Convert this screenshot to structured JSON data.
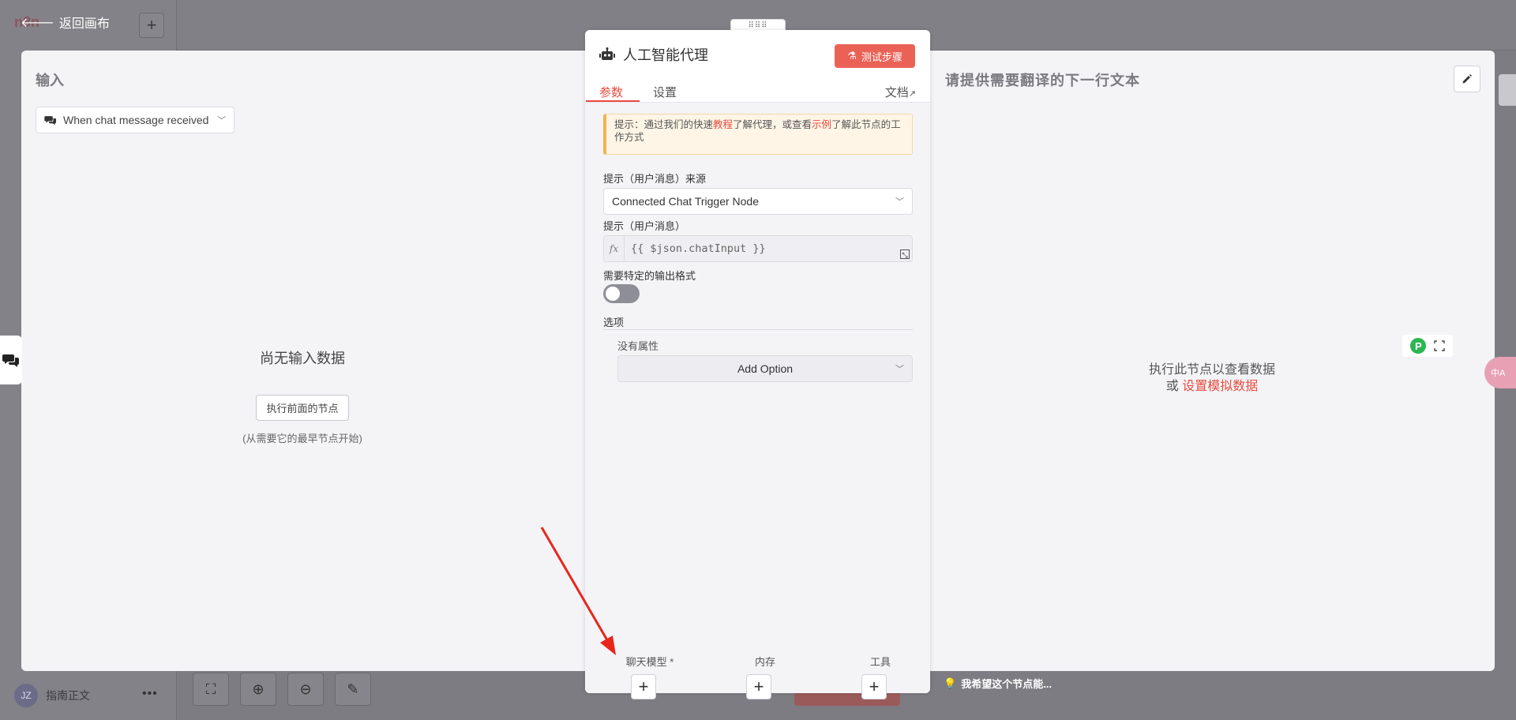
{
  "background": {
    "logo_text": "n8n",
    "back_label": "返回画布",
    "user_initials": "JZ",
    "user_name": "指南正文",
    "more": "•••"
  },
  "input_panel": {
    "title": "输入",
    "trigger_select": "When chat message received",
    "empty_title": "尚无输入数据",
    "run_previous_button": "执行前面的节点",
    "empty_sub": "(从需要它的最早节点开始)"
  },
  "node": {
    "title": "人工智能代理",
    "test_button": "测试步骤",
    "tabs": [
      "参数",
      "设置"
    ],
    "docs_link": "文档",
    "hint": {
      "prefix": "提示：通过我们的快速",
      "link1": "教程",
      "middle": "了解代理，或查看",
      "link2": "示例",
      "suffix": "了解此节点的工作方式"
    },
    "prompt_source_label": "提示（用户消息）来源",
    "prompt_source_value": "Connected Chat Trigger Node",
    "prompt_label": "提示（用户消息）",
    "prompt_fx": "fx",
    "prompt_value": "{{ $json.chatInput }}",
    "output_format_label": "需要特定的输出格式",
    "output_format_enabled": false,
    "options_label": "选项",
    "no_properties": "没有属性",
    "add_option": "Add Option",
    "sub_inputs": [
      {
        "label": "聊天模型 *"
      },
      {
        "label": "内存"
      },
      {
        "label": "工具"
      }
    ]
  },
  "output_panel": {
    "title": "请提供需要翻译的下一行文本",
    "empty_line1": "执行此节点以查看数据",
    "empty_or": "或",
    "empty_link": "设置模拟数据"
  },
  "wish_hint": "我希望这个节点能...",
  "translate_badge": "中A",
  "colors": {
    "accent": "#ea4b3f",
    "hint_bg": "#fef5e6",
    "hint_border": "#f0b44c",
    "overlay": "#7d7c82"
  }
}
